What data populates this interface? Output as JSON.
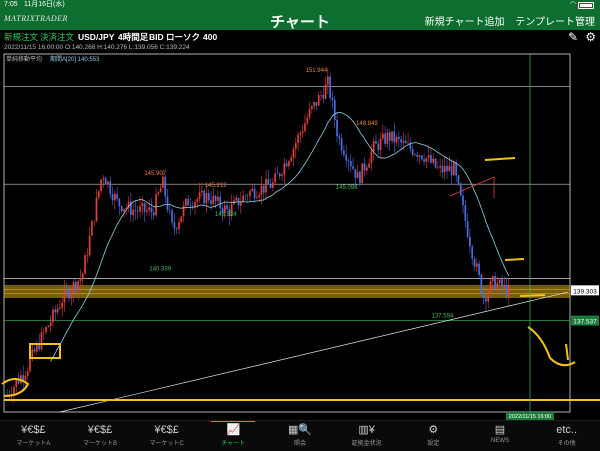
{
  "status": {
    "time": "7:05",
    "date": "11月16日(水)",
    "wifi_icon": "wifi-icon",
    "battery_icon": "battery-icon"
  },
  "nav": {
    "logo": "MATRIXTRADER",
    "title": "チャート",
    "add_chart": "新規チャート追加",
    "template": "テンプレート管理"
  },
  "toolbar": {
    "new_order": "新規注文",
    "settle_order": "決済注文",
    "pair": "USD/JPY",
    "timeframe": "4時間足",
    "side": "BID",
    "candle_type": "ローソク",
    "count": "400",
    "edit_icon": "pencil-icon",
    "settings_icon": "gear-icon"
  },
  "ohlc": "2022/11/15 16:00:00  O:140.268  H:140.276  L:139.056  C:139.224",
  "indicator": {
    "name": "単純移動平均",
    "label": "期間A[20] 140.553"
  },
  "chart_data": {
    "type": "candlestick",
    "instrument": "USD/JPY",
    "timeframe": "4h",
    "last_datetime": "2022/11/15 16:00",
    "last_ohlc": {
      "open": 140.268,
      "high": 140.276,
      "low": 139.056,
      "close": 139.224
    },
    "ylim": [
      132.2,
      153.1
    ],
    "sma": {
      "period": 20,
      "value": 140.553
    },
    "annotations": [
      {
        "text": "151.944",
        "x": 0.62,
        "y": 151.944,
        "color": "#e8863a"
      },
      {
        "text": "145.907",
        "x": 0.3,
        "y": 145.907,
        "color": "#e8863a"
      },
      {
        "text": "145.212",
        "x": 0.42,
        "y": 145.212,
        "color": "#e8863a"
      },
      {
        "text": "148.849",
        "x": 0.72,
        "y": 148.849,
        "color": "#e8863a"
      },
      {
        "text": "143.524",
        "x": 0.44,
        "y": 143.524,
        "color": "#3fbf5a"
      },
      {
        "text": "145.098",
        "x": 0.68,
        "y": 145.098,
        "color": "#3fbf5a"
      },
      {
        "text": "140.339",
        "x": 0.31,
        "y": 140.339,
        "color": "#3fbf5a"
      },
      {
        "text": "137.594",
        "x": 0.87,
        "y": 137.594,
        "color": "#3fbf5a"
      }
    ],
    "price_tags": [
      {
        "text": "139.303",
        "value": 139.303,
        "bg": "#ffffff",
        "fg": "#000000"
      },
      {
        "text": "137.537",
        "value": 137.537,
        "bg": "#1c7d3a",
        "fg": "#ffffff"
      }
    ],
    "time_tag": "2022/11/15 16:00",
    "colors": {
      "up": "#e0413a",
      "down": "#4a6ee0",
      "sma": "#8fd0e6",
      "band": "#d8a91e",
      "marker": "#f2c21a",
      "crosshair": "#3fbf5a"
    }
  },
  "tabs": [
    {
      "label": "マーケットA",
      "icon": "currency-icon",
      "glyph": "¥€$£"
    },
    {
      "label": "マーケットB",
      "icon": "currency-icon",
      "glyph": "¥€$£"
    },
    {
      "label": "マーケットC",
      "icon": "currency-icon",
      "glyph": "¥€$£"
    },
    {
      "label": "チャート",
      "icon": "chart-icon",
      "glyph": "📈"
    },
    {
      "label": "照会",
      "icon": "search-icon",
      "glyph": "▦🔍"
    },
    {
      "label": "証拠金状況",
      "icon": "margin-icon",
      "glyph": "▥¥"
    },
    {
      "label": "設定",
      "icon": "settings-icon",
      "glyph": "⚙"
    },
    {
      "label": "NEWS",
      "icon": "news-icon",
      "glyph": "▤"
    },
    {
      "label": "その他",
      "icon": "more-icon",
      "glyph": "etc.."
    }
  ]
}
